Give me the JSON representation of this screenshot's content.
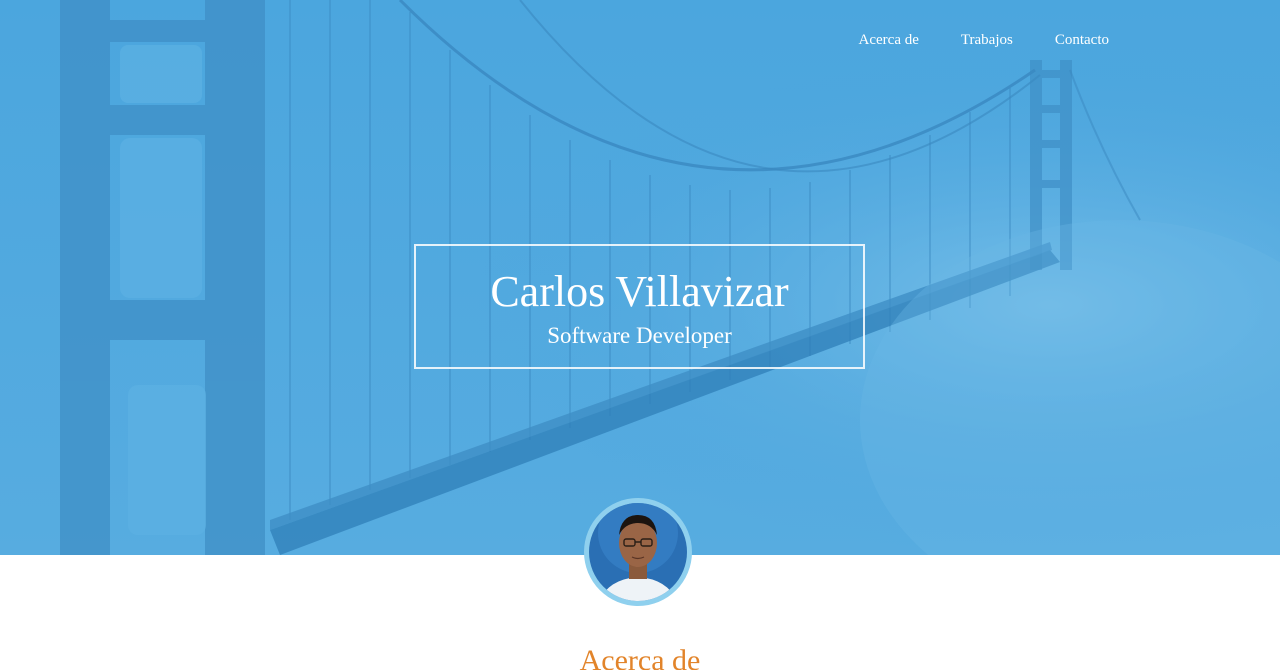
{
  "nav": {
    "items": [
      {
        "label": "Acerca de"
      },
      {
        "label": "Trabajos"
      },
      {
        "label": "Contacto"
      }
    ]
  },
  "hero": {
    "name": "Carlos Villavizar",
    "role": "Software Developer",
    "background": "golden-gate-bridge-fog-photo",
    "overlay_color": "#4aa3dc"
  },
  "avatar": {
    "alt": "profile-photo"
  },
  "about": {
    "heading": "Acerca de"
  },
  "colors": {
    "accent": "#e2842a",
    "hero_blue": "#4aa3dc",
    "text_light": "#ffffff"
  }
}
